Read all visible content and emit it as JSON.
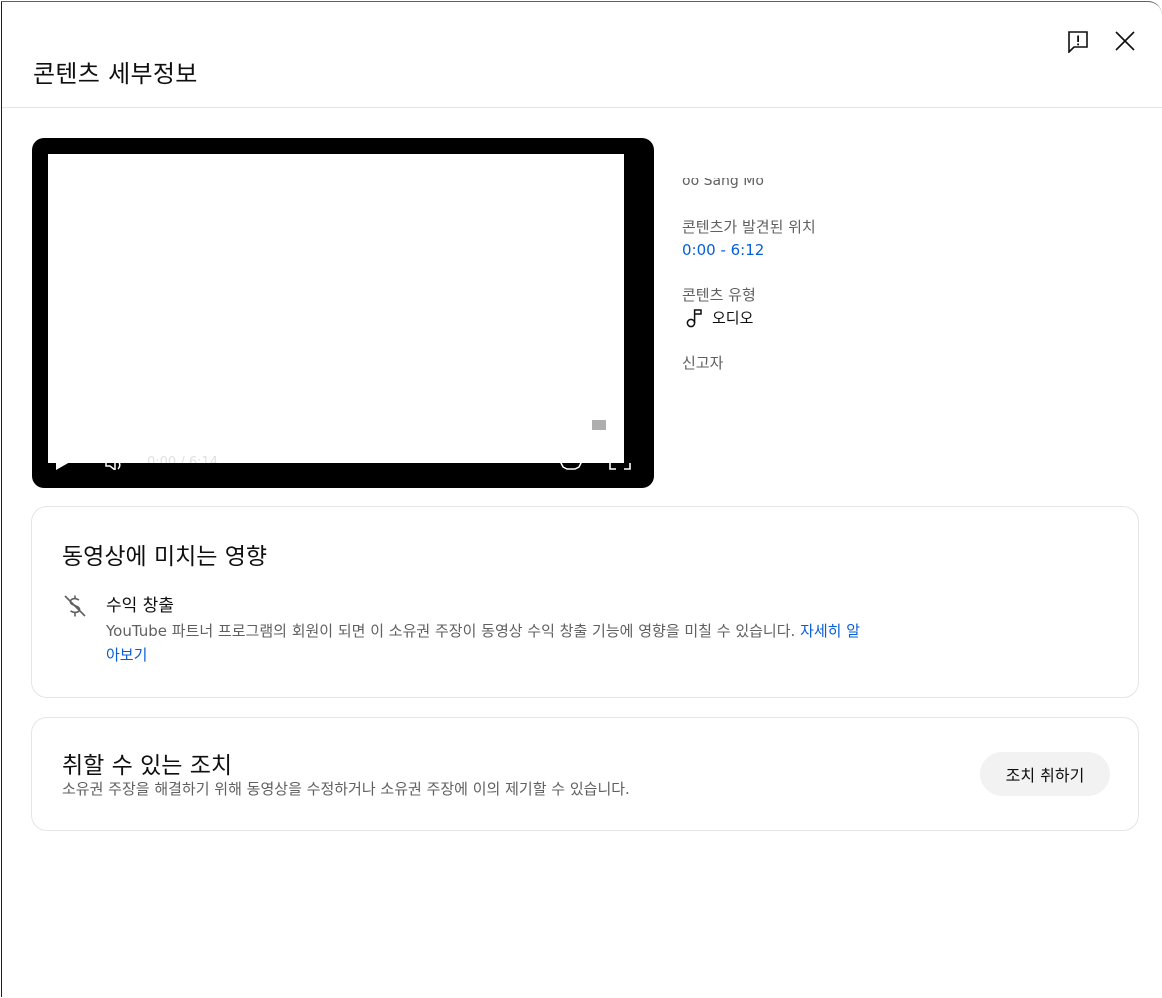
{
  "dialog": {
    "title": "콘텐츠 세부정보",
    "feedback_icon": "feedback-flag-icon",
    "close_icon": "close-icon"
  },
  "player": {
    "time_display": "0:00 / 6:14"
  },
  "meta": {
    "cutoff_text": "oo Sang Mo",
    "location_label": "콘텐츠가 발견된 위치",
    "location_value": "0:00 - 6:12",
    "type_label": "콘텐츠 유형",
    "type_value": "오디오",
    "reporter_label": "신고자"
  },
  "impact": {
    "title": "동영상에 미치는 영향",
    "item_title": "수익 창출",
    "item_desc": "YouTube 파트너 프로그램의 회원이 되면 이 소유권 주장이 동영상 수익 창출 기능에 영향을 미칠 수 있습니다.",
    "item_link": "자세히 알아보기"
  },
  "actions": {
    "title": "취할 수 있는 조치",
    "desc": "소유권 주장을 해결하기 위해 동영상을 수정하거나 소유권 주장에 이의 제기할 수 있습니다.",
    "button_label": "조치 취하기"
  },
  "colors": {
    "link": "#065fd4",
    "secondary_text": "#606060",
    "button_bg": "#f2f2f2"
  }
}
